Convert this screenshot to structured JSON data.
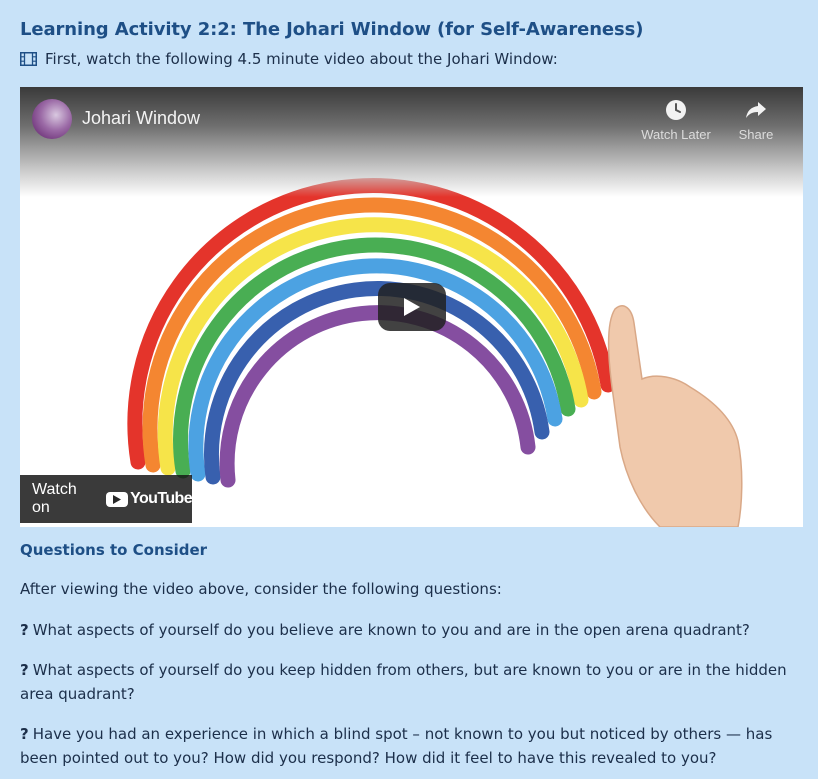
{
  "activity": {
    "title": "Learning Activity 2:2: The Johari Window (for Self-Awareness)",
    "intro": "First, watch the following 4.5 minute video about the Johari Window:",
    "intro_icon": "film-icon"
  },
  "video": {
    "title": "Johari Window",
    "watch_later": "Watch Later",
    "share": "Share",
    "watch_on": "Watch on",
    "youtube": "YouTube"
  },
  "questions": {
    "heading": "Questions to Consider",
    "lead": "After viewing the video above, consider the following questions:",
    "items": [
      {
        "mark": "?",
        "text": "What aspects of yourself do you believe are known to you and are in the open arena quadrant?"
      },
      {
        "mark": "?",
        "text": "What aspects of yourself do you keep hidden from others, but are known to you or are in the hidden area quadrant?"
      },
      {
        "mark": "?",
        "text": "Have you had an experience in which a blind spot – not known to you but noticed by others — has been pointed out to you? How did you respond? How did it feel to have this revealed to you?"
      }
    ]
  }
}
